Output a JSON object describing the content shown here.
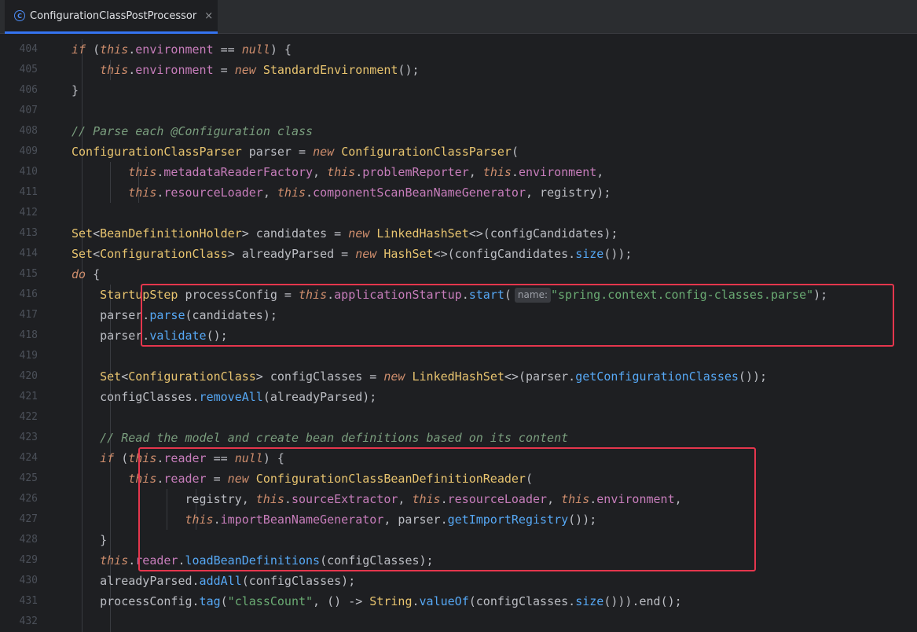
{
  "tab": {
    "title": "ConfigurationClassPostProcessor",
    "icon_letter": "C",
    "close": "×"
  },
  "lines": [
    {
      "num": "404",
      "indent": 2,
      "tokens": [
        [
          "kw",
          "if"
        ],
        [
          "p",
          " ("
        ],
        [
          "kw",
          "this"
        ],
        [
          "p",
          "."
        ],
        [
          "fld",
          "environment"
        ],
        [
          "p",
          " == "
        ],
        [
          "kw",
          "null"
        ],
        [
          "p",
          ") {"
        ]
      ]
    },
    {
      "num": "405",
      "indent": 3,
      "tokens": [
        [
          "kw",
          "this"
        ],
        [
          "p",
          "."
        ],
        [
          "fld",
          "environment"
        ],
        [
          "p",
          " = "
        ],
        [
          "kw",
          "new"
        ],
        [
          "p",
          " "
        ],
        [
          "cls",
          "StandardEnvironment"
        ],
        [
          "p",
          "();"
        ]
      ]
    },
    {
      "num": "406",
      "indent": 2,
      "tokens": [
        [
          "p",
          "}"
        ]
      ]
    },
    {
      "num": "407",
      "indent": 2,
      "tokens": []
    },
    {
      "num": "408",
      "indent": 2,
      "tokens": [
        [
          "cmt",
          "// Parse each @Configuration class"
        ]
      ]
    },
    {
      "num": "409",
      "indent": 2,
      "tokens": [
        [
          "cls",
          "ConfigurationClassParser"
        ],
        [
          "p",
          " parser = "
        ],
        [
          "kw",
          "new"
        ],
        [
          "p",
          " "
        ],
        [
          "cls",
          "ConfigurationClassParser"
        ],
        [
          "p",
          "("
        ]
      ]
    },
    {
      "num": "410",
      "indent": 4,
      "tokens": [
        [
          "kw",
          "this"
        ],
        [
          "p",
          "."
        ],
        [
          "fld",
          "metadataReaderFactory"
        ],
        [
          "p",
          ", "
        ],
        [
          "kw",
          "this"
        ],
        [
          "p",
          "."
        ],
        [
          "fld",
          "problemReporter"
        ],
        [
          "p",
          ", "
        ],
        [
          "kw",
          "this"
        ],
        [
          "p",
          "."
        ],
        [
          "fld",
          "environment"
        ],
        [
          "p",
          ","
        ]
      ]
    },
    {
      "num": "411",
      "indent": 4,
      "tokens": [
        [
          "kw",
          "this"
        ],
        [
          "p",
          "."
        ],
        [
          "fld",
          "resourceLoader"
        ],
        [
          "p",
          ", "
        ],
        [
          "kw",
          "this"
        ],
        [
          "p",
          "."
        ],
        [
          "fld",
          "componentScanBeanNameGenerator"
        ],
        [
          "p",
          ", registry);"
        ]
      ]
    },
    {
      "num": "412",
      "indent": 2,
      "tokens": []
    },
    {
      "num": "413",
      "indent": 2,
      "tokens": [
        [
          "cls",
          "Set"
        ],
        [
          "p",
          "<"
        ],
        [
          "cls",
          "BeanDefinitionHolder"
        ],
        [
          "p",
          "> candidates = "
        ],
        [
          "kw",
          "new"
        ],
        [
          "p",
          " "
        ],
        [
          "cls",
          "LinkedHashSet"
        ],
        [
          "p",
          "<>(configCandidates);"
        ]
      ]
    },
    {
      "num": "414",
      "indent": 2,
      "tokens": [
        [
          "cls",
          "Set"
        ],
        [
          "p",
          "<"
        ],
        [
          "cls",
          "ConfigurationClass"
        ],
        [
          "p",
          "> alreadyParsed = "
        ],
        [
          "kw",
          "new"
        ],
        [
          "p",
          " "
        ],
        [
          "cls",
          "HashSet"
        ],
        [
          "p",
          "<>(configCandidates."
        ],
        [
          "mth",
          "size"
        ],
        [
          "p",
          "());"
        ]
      ]
    },
    {
      "num": "415",
      "indent": 2,
      "tokens": [
        [
          "kw",
          "do"
        ],
        [
          "p",
          " {"
        ]
      ]
    },
    {
      "num": "416",
      "indent": 3,
      "tokens": [
        [
          "cls",
          "StartupStep"
        ],
        [
          "p",
          " processConfig = "
        ],
        [
          "kw",
          "this"
        ],
        [
          "p",
          "."
        ],
        [
          "fld",
          "applicationStartup"
        ],
        [
          "p",
          "."
        ],
        [
          "mth",
          "start"
        ],
        [
          "p",
          "("
        ],
        [
          "hint",
          "name:"
        ],
        [
          "str",
          "\"spring.context.config-classes.parse\""
        ],
        [
          "p",
          ");"
        ]
      ]
    },
    {
      "num": "417",
      "indent": 3,
      "tokens": [
        [
          "p",
          "parser."
        ],
        [
          "mth",
          "parse"
        ],
        [
          "p",
          "(candidates);"
        ]
      ]
    },
    {
      "num": "418",
      "indent": 3,
      "tokens": [
        [
          "p",
          "parser."
        ],
        [
          "mth",
          "validate"
        ],
        [
          "p",
          "();"
        ]
      ]
    },
    {
      "num": "419",
      "indent": 3,
      "tokens": []
    },
    {
      "num": "420",
      "indent": 3,
      "tokens": [
        [
          "cls",
          "Set"
        ],
        [
          "p",
          "<"
        ],
        [
          "cls",
          "ConfigurationClass"
        ],
        [
          "p",
          "> configClasses = "
        ],
        [
          "kw",
          "new"
        ],
        [
          "p",
          " "
        ],
        [
          "cls",
          "LinkedHashSet"
        ],
        [
          "p",
          "<>(parser."
        ],
        [
          "mth",
          "getConfigurationClasses"
        ],
        [
          "p",
          "());"
        ]
      ]
    },
    {
      "num": "421",
      "indent": 3,
      "tokens": [
        [
          "p",
          "configClasses."
        ],
        [
          "mth",
          "removeAll"
        ],
        [
          "p",
          "(alreadyParsed);"
        ]
      ]
    },
    {
      "num": "422",
      "indent": 3,
      "tokens": []
    },
    {
      "num": "423",
      "indent": 3,
      "tokens": [
        [
          "cmt",
          "// Read the model and create bean definitions based on its content"
        ]
      ]
    },
    {
      "num": "424",
      "indent": 3,
      "tokens": [
        [
          "kw",
          "if"
        ],
        [
          "p",
          " ("
        ],
        [
          "kw",
          "this"
        ],
        [
          "p",
          "."
        ],
        [
          "fld",
          "reader"
        ],
        [
          "p",
          " == "
        ],
        [
          "kw",
          "null"
        ],
        [
          "p",
          ") {"
        ]
      ]
    },
    {
      "num": "425",
      "indent": 4,
      "tokens": [
        [
          "kw",
          "this"
        ],
        [
          "p",
          "."
        ],
        [
          "fld",
          "reader"
        ],
        [
          "p",
          " = "
        ],
        [
          "kw",
          "new"
        ],
        [
          "p",
          " "
        ],
        [
          "cls",
          "ConfigurationClassBeanDefinitionReader"
        ],
        [
          "p",
          "("
        ]
      ]
    },
    {
      "num": "426",
      "indent": 6,
      "tokens": [
        [
          "p",
          "registry, "
        ],
        [
          "kw",
          "this"
        ],
        [
          "p",
          "."
        ],
        [
          "fld",
          "sourceExtractor"
        ],
        [
          "p",
          ", "
        ],
        [
          "kw",
          "this"
        ],
        [
          "p",
          "."
        ],
        [
          "fld",
          "resourceLoader"
        ],
        [
          "p",
          ", "
        ],
        [
          "kw",
          "this"
        ],
        [
          "p",
          "."
        ],
        [
          "fld",
          "environment"
        ],
        [
          "p",
          ","
        ]
      ]
    },
    {
      "num": "427",
      "indent": 6,
      "tokens": [
        [
          "kw",
          "this"
        ],
        [
          "p",
          "."
        ],
        [
          "fld",
          "importBeanNameGenerator"
        ],
        [
          "p",
          ", parser."
        ],
        [
          "mth",
          "getImportRegistry"
        ],
        [
          "p",
          "());"
        ]
      ]
    },
    {
      "num": "428",
      "indent": 3,
      "tokens": [
        [
          "p",
          "}"
        ]
      ]
    },
    {
      "num": "429",
      "indent": 3,
      "tokens": [
        [
          "kw",
          "this"
        ],
        [
          "p",
          "."
        ],
        [
          "fld",
          "reader"
        ],
        [
          "p",
          "."
        ],
        [
          "mth",
          "loadBeanDefinitions"
        ],
        [
          "p",
          "(configClasses);"
        ]
      ]
    },
    {
      "num": "430",
      "indent": 3,
      "tokens": [
        [
          "p",
          "alreadyParsed."
        ],
        [
          "mth",
          "addAll"
        ],
        [
          "p",
          "(configClasses);"
        ]
      ]
    },
    {
      "num": "431",
      "indent": 3,
      "tokens": [
        [
          "p",
          "processConfig."
        ],
        [
          "mth",
          "tag"
        ],
        [
          "p",
          "("
        ],
        [
          "str",
          "\"classCount\""
        ],
        [
          "p",
          ", () -> "
        ],
        [
          "cls",
          "String"
        ],
        [
          "p",
          "."
        ],
        [
          "mth",
          "valueOf"
        ],
        [
          "p",
          "(configClasses."
        ],
        [
          "mth",
          "size"
        ],
        [
          "p",
          "())).end();"
        ]
      ]
    },
    {
      "num": "432",
      "indent": 3,
      "tokens": []
    }
  ],
  "highlights": [
    {
      "name": "highlight-box-startup-step",
      "from_line": "416",
      "to_line": "418"
    },
    {
      "name": "highlight-box-reader-init",
      "from_line": "424",
      "to_line": "429"
    }
  ]
}
